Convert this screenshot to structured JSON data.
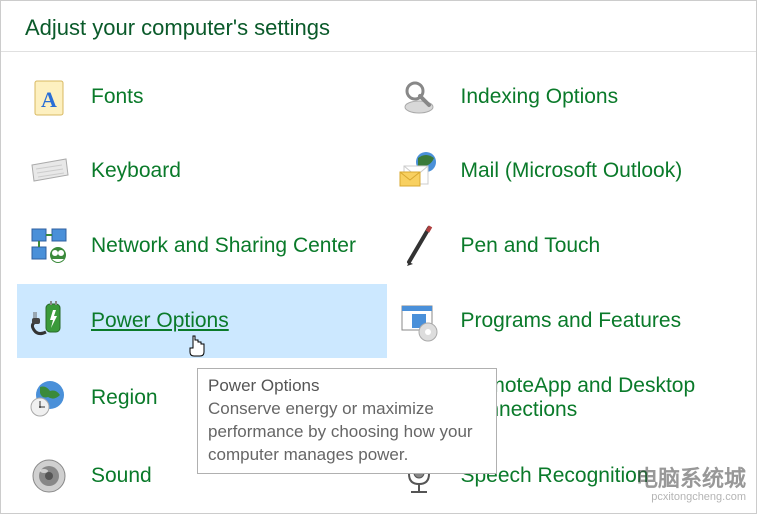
{
  "header": {
    "title": "Adjust your computer's settings"
  },
  "items": [
    {
      "label": "Fonts"
    },
    {
      "label": "Indexing Options"
    },
    {
      "label": "Keyboard"
    },
    {
      "label": "Mail (Microsoft Outlook)"
    },
    {
      "label": "Network and Sharing Center"
    },
    {
      "label": "Pen and Touch"
    },
    {
      "label": "Power Options"
    },
    {
      "label": "Programs and Features"
    },
    {
      "label": "Region"
    },
    {
      "label": "RemoteApp and Desktop Connections"
    },
    {
      "label": "Sound"
    },
    {
      "label": "Speech Recognition"
    }
  ],
  "tooltip": {
    "title": "Power Options",
    "body": "Conserve energy or maximize performance by choosing how your computer manages power."
  },
  "watermark": {
    "text": "电脑系统城",
    "url": "pcxitongcheng.com"
  }
}
